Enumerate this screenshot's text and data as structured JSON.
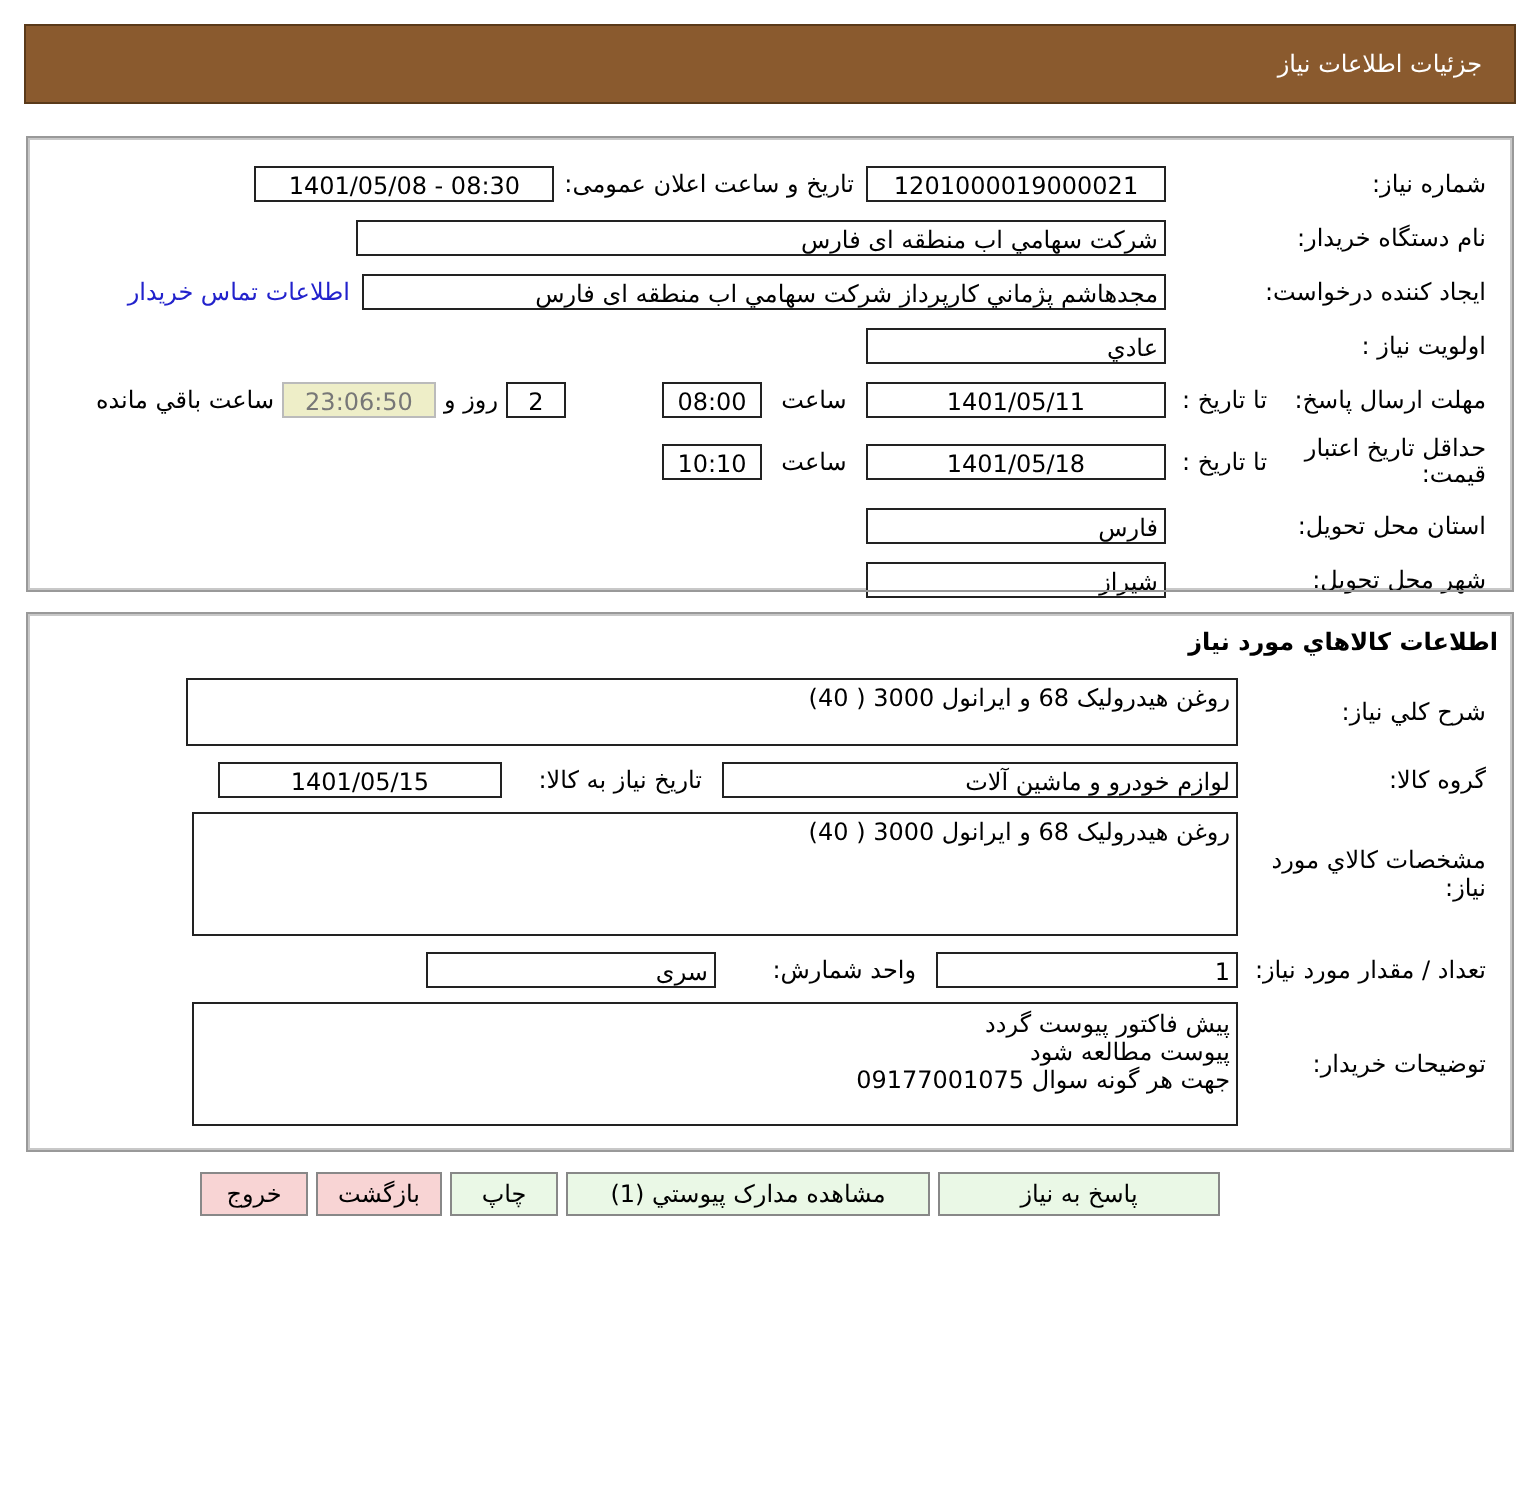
{
  "header": {
    "title": "جزئیات اطلاعات نیاز"
  },
  "details": {
    "need_number": {
      "label": "شماره نیاز:",
      "value": "1201000019000021"
    },
    "announce": {
      "label": "تاریخ و ساعت اعلان عمومی:",
      "value": "1401/05/08 - 08:30"
    },
    "buyer_org": {
      "label": "نام دستگاه خریدار:",
      "value": "شرکت سهامي اب منطقه ای فارس"
    },
    "requester": {
      "label": "ایجاد کننده درخواست:",
      "value": "مجدهاشم پژماني کارپرداز شرکت سهامي اب منطقه ای فارس",
      "link": "اطلاعات تماس خریدار"
    },
    "priority": {
      "label": "اولویت نیاز :",
      "value": "عادي"
    },
    "deadline": {
      "label": "مهلت ارسال پاسخ:",
      "sublabel": "تا تاریخ :",
      "date": "1401/05/11",
      "time_label": "ساعت",
      "time": "08:00",
      "days": "2",
      "days_label": "روز و",
      "remaining": "23:06:50",
      "remaining_label": "ساعت باقي مانده"
    },
    "validity": {
      "label": "حداقل تاریخ اعتبار قیمت:",
      "sublabel": "تا تاریخ :",
      "date": "1401/05/18",
      "time_label": "ساعت",
      "time": "10:10"
    },
    "province": {
      "label": "استان محل تحویل:",
      "value": "فارس"
    },
    "city": {
      "label": "شهر محل تحویل:",
      "value": "شیراز"
    }
  },
  "goods": {
    "title": "اطلاعات کالاهاي مورد نیاز",
    "summary": {
      "label": "شرح کلي نیاز:",
      "value": "روغن هیدرولیک  68 و ایرانول 3000 ( 40)"
    },
    "group": {
      "label": "گروه کالا:",
      "value": "لوازم خودرو و ماشین آلات",
      "date_label": "تاریخ نیاز به کالا:",
      "date": "1401/05/15"
    },
    "specs": {
      "label": "مشخصات کالاي مورد نیاز:",
      "value": "روغن هیدرولیک 68 و ایرانول 3000 ( 40)"
    },
    "quantity": {
      "label": "تعداد / مقدار مورد نیاز:",
      "value": "1",
      "unit_label": "واحد شمارش:",
      "unit": "سری"
    },
    "notes": {
      "label": "توضیحات خریدار:",
      "lines": [
        "پیش فاکتور پیوست گردد",
        "پیوست مطالعه شود",
        "جهت هر گونه سوال 09177001075"
      ]
    }
  },
  "buttons": [
    {
      "label": "پاسخ به نیاز",
      "kind": "normal"
    },
    {
      "label": "مشاهده مدارک پیوستي (1)",
      "kind": "normal"
    },
    {
      "label": "چاپ",
      "kind": "normal"
    },
    {
      "label": "بازگشت",
      "kind": "danger"
    },
    {
      "label": "خروج",
      "kind": "danger"
    }
  ]
}
